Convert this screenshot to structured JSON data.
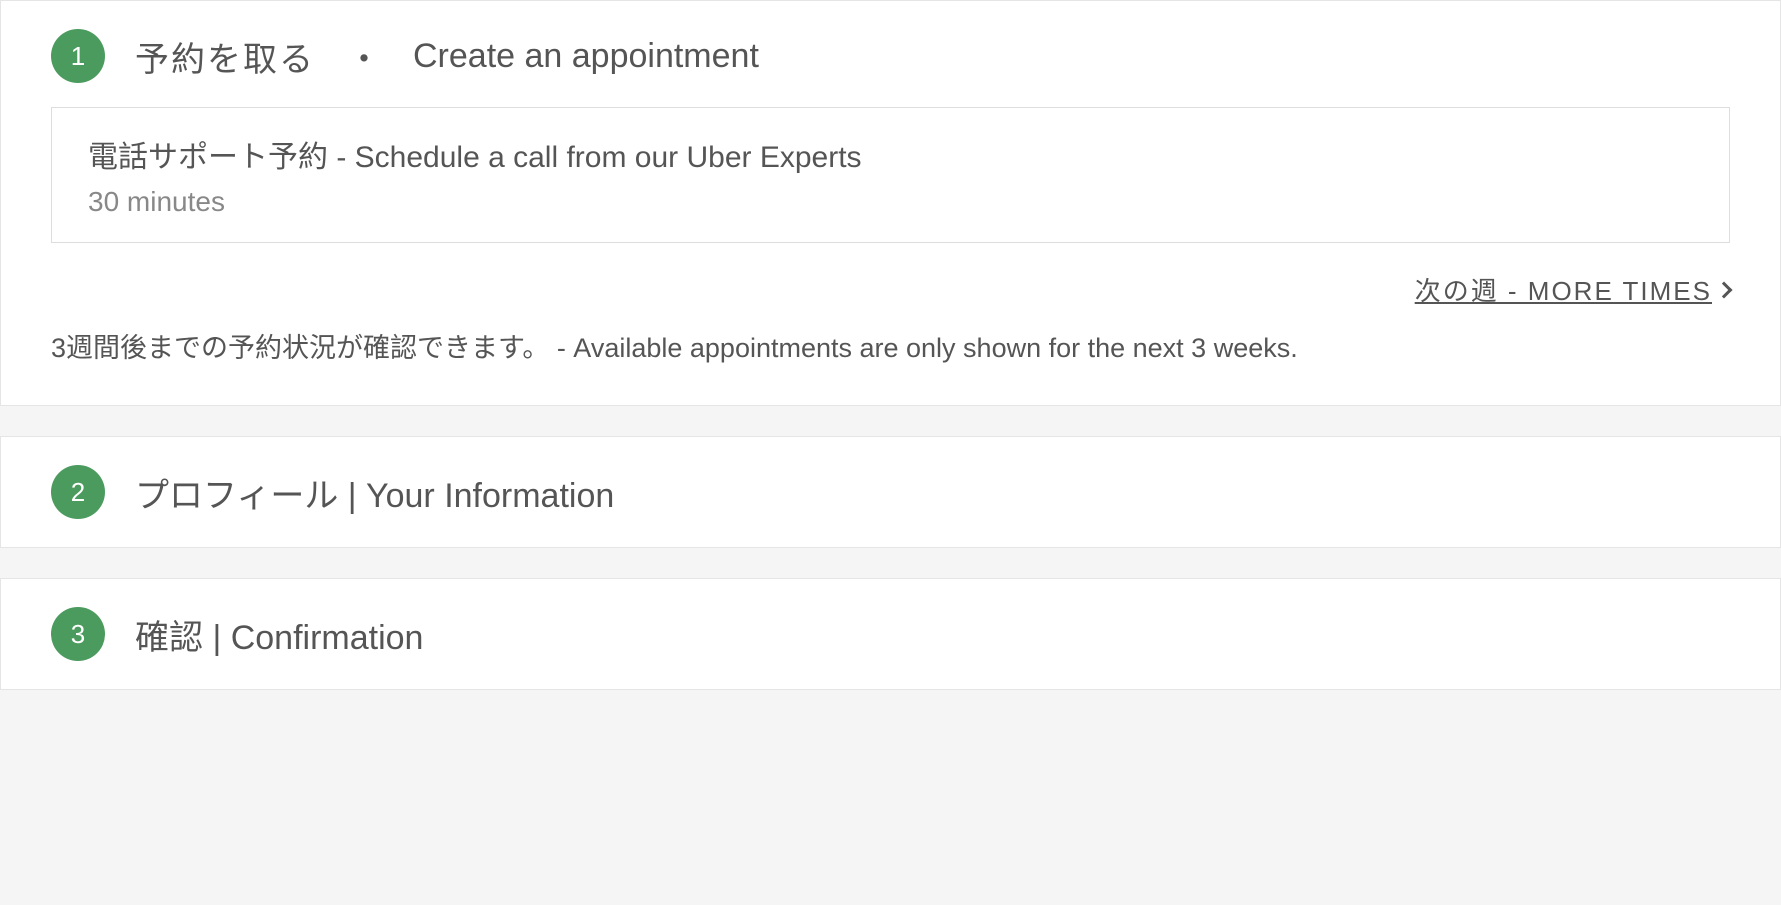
{
  "steps": [
    {
      "number": "1",
      "title_jp": "予約を取る",
      "title_sep": "・",
      "title_en": "Create an appointment"
    },
    {
      "number": "2",
      "title_full": "プロフィール | Your Information"
    },
    {
      "number": "3",
      "title_full": "確認 | Confirmation"
    }
  ],
  "appointment": {
    "title": "電話サポート予約 - Schedule a call from our Uber Experts",
    "duration": "30 minutes"
  },
  "more_times": {
    "label": "次の週 - MORE TIMES"
  },
  "availability_note": "3週間後までの予約状況が確認できます。 - Available appointments are only shown for the next 3 weeks."
}
